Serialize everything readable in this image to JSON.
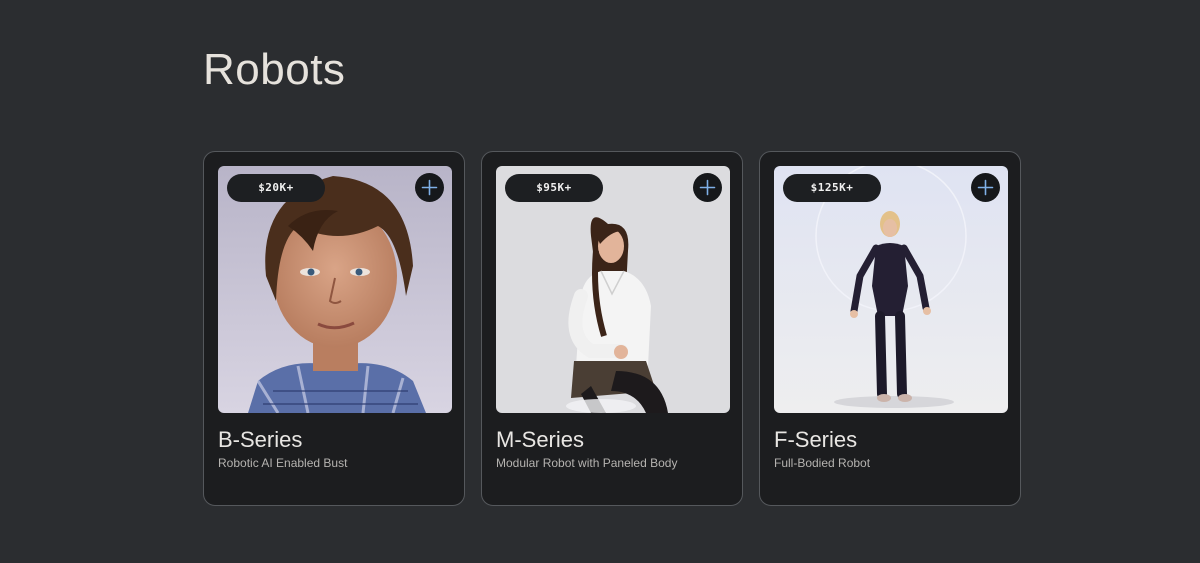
{
  "page": {
    "title": "Robots"
  },
  "cards": [
    {
      "price": "$20K+",
      "title": "B-Series",
      "subtitle": "Robotic AI Enabled Bust",
      "image": "humanoid-bust-photo"
    },
    {
      "price": "$95K+",
      "title": "M-Series",
      "subtitle": "Modular Robot with Paneled Body",
      "image": "seated-humanoid-photo"
    },
    {
      "price": "$125K+",
      "title": "F-Series",
      "subtitle": "Full-Bodied Robot",
      "image": "standing-humanoid-photo"
    }
  ],
  "icons": {
    "add": "plus-icon"
  },
  "colors": {
    "background": "#2b2d30",
    "card": "#1c1d1f",
    "card_border": "#55585c",
    "plus_accent": "#7fb0e8"
  }
}
